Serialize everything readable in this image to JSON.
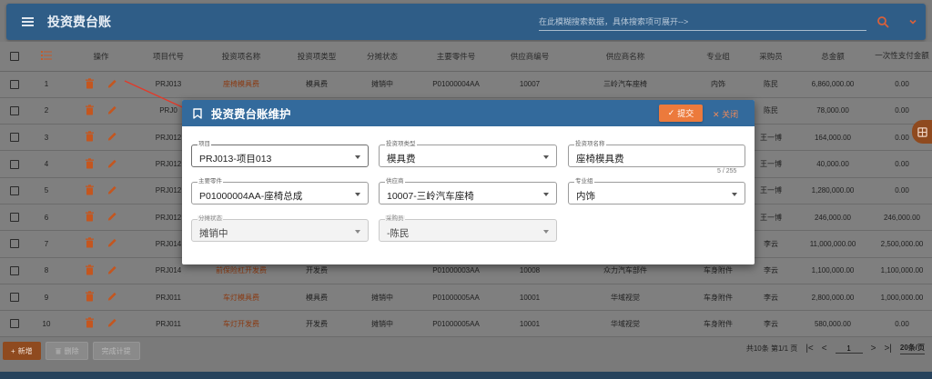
{
  "app": {
    "title": "投资费台账",
    "search_placeholder": "在此模糊搜索数据，具体搜索项可展开-->"
  },
  "table": {
    "headers": [
      "操作",
      "项目代号",
      "投资项名称",
      "投资项类型",
      "分摊状态",
      "主要零件号",
      "供应商编号",
      "供应商名称",
      "专业组",
      "采购员",
      "总金额",
      "一次性支付金额"
    ],
    "rows": [
      {
        "no": "1",
        "project": "PRJ013",
        "name": "座椅模具费",
        "type": "模具费",
        "status": "摊销中",
        "part": "P01000004AA",
        "supplier_no": "10007",
        "supplier": "三岭汽车座椅",
        "group": "内饰",
        "buyer": "陈民",
        "total": "6,860,000.00",
        "once": "0.00"
      },
      {
        "no": "2",
        "project": "PRJ0",
        "name": "",
        "type": "",
        "status": "",
        "part": "",
        "supplier_no": "",
        "supplier": "",
        "group": "",
        "buyer": "陈民",
        "total": "78,000.00",
        "once": "0.00"
      },
      {
        "no": "3",
        "project": "PRJ012",
        "name": "",
        "type": "",
        "status": "",
        "part": "",
        "supplier_no": "",
        "supplier": "",
        "group": "",
        "buyer": "王一博",
        "total": "164,000.00",
        "once": "0.00"
      },
      {
        "no": "4",
        "project": "PRJ012",
        "name": "",
        "type": "",
        "status": "",
        "part": "",
        "supplier_no": "",
        "supplier": "",
        "group": "",
        "buyer": "王一博",
        "total": "40,000.00",
        "once": "0.00"
      },
      {
        "no": "5",
        "project": "PRJ012",
        "name": "",
        "type": "",
        "status": "",
        "part": "",
        "supplier_no": "",
        "supplier": "",
        "group": "",
        "buyer": "王一博",
        "total": "1,280,000.00",
        "once": "0.00"
      },
      {
        "no": "6",
        "project": "PRJ012",
        "name": "",
        "type": "",
        "status": "",
        "part": "",
        "supplier_no": "",
        "supplier": "",
        "group": "",
        "buyer": "王一博",
        "total": "246,000.00",
        "once": "246,000.00"
      },
      {
        "no": "7",
        "project": "PRJ014",
        "name": "",
        "type": "",
        "status": "",
        "part": "",
        "supplier_no": "",
        "supplier": "",
        "group": "",
        "buyer": "李云",
        "total": "11,000,000.00",
        "once": "2,500,000.00"
      },
      {
        "no": "8",
        "project": "PRJ014",
        "name": "前保险杠开发费",
        "type": "开发费",
        "status": "",
        "part": "P01000003AA",
        "supplier_no": "10008",
        "supplier": "众力汽车部件",
        "group": "车身附件",
        "buyer": "李云",
        "total": "1,100,000.00",
        "once": "1,100,000.00"
      },
      {
        "no": "9",
        "project": "PRJ011",
        "name": "车灯模具费",
        "type": "模具费",
        "status": "摊销中",
        "part": "P01000005AA",
        "supplier_no": "10001",
        "supplier": "华域视觉",
        "group": "车身附件",
        "buyer": "李云",
        "total": "2,800,000.00",
        "once": "1,000,000.00"
      },
      {
        "no": "10",
        "project": "PRJ011",
        "name": "车灯开发费",
        "type": "开发费",
        "status": "摊销中",
        "part": "P01000005AA",
        "supplier_no": "10001",
        "supplier": "华域视觉",
        "group": "车身附件",
        "buyer": "李云",
        "total": "580,000.00",
        "once": "0.00"
      }
    ]
  },
  "footer": {
    "add_label": "新增",
    "delete_label": "删除",
    "complete_label": "完成计提",
    "summary": "共10条 第1/1 页",
    "page_value": "1",
    "page_size": "20条/页"
  },
  "modal": {
    "title": "投资费台账维护",
    "submit_label": "提交",
    "close_label": "关闭",
    "counter": "5 / 255",
    "fields": {
      "project": {
        "label": "项目",
        "value": "PRJ013-项目013"
      },
      "type": {
        "label": "投资项类型",
        "value": "模具费"
      },
      "name": {
        "label": "投资项名称",
        "value": "座椅模具费"
      },
      "part": {
        "label": "主要零件",
        "value": "P01000004AA-座椅总成"
      },
      "supplier": {
        "label": "供应商",
        "value": "10007-三岭汽车座椅"
      },
      "group": {
        "label": "专业组",
        "value": "内饰"
      },
      "status": {
        "label": "分摊状态",
        "value": "摊销中"
      },
      "buyer": {
        "label": "采购员",
        "value": "-陈民"
      }
    }
  },
  "colors": {
    "header_bg": "#2f5d87",
    "modal_header": "#336a9c",
    "accent_orange": "#ec7a3c",
    "link_brown": "#8a3a12"
  }
}
